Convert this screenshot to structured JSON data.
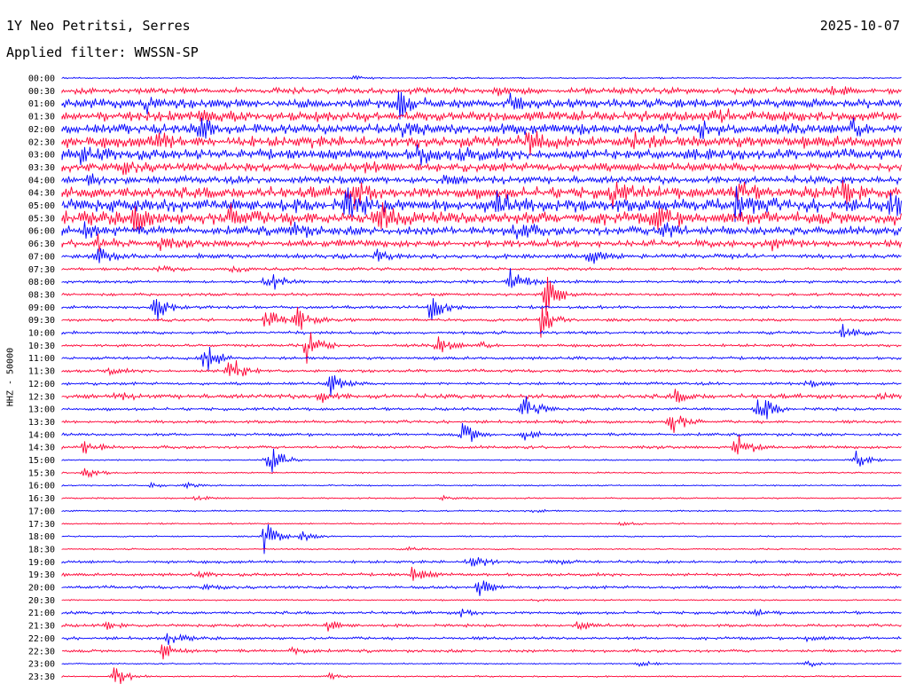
{
  "header": {
    "station": "1Y Neo Petritsi, Serres",
    "filter": "Applied filter: WWSSN-SP",
    "date": "2025-10-07"
  },
  "axis": {
    "ylabel": "HHZ - 50000"
  },
  "colors": {
    "blue": "#0000ff",
    "red": "#ff0033"
  },
  "time_labels": [
    "00:00",
    "00:30",
    "01:00",
    "01:30",
    "02:00",
    "02:30",
    "03:00",
    "03:30",
    "04:00",
    "04:30",
    "05:00",
    "05:30",
    "06:00",
    "06:30",
    "07:00",
    "07:30",
    "08:00",
    "08:30",
    "09:00",
    "09:30",
    "10:00",
    "10:30",
    "11:00",
    "11:30",
    "12:00",
    "12:30",
    "13:00",
    "13:30",
    "14:00",
    "14:30",
    "15:00",
    "15:30",
    "16:00",
    "16:30",
    "17:00",
    "17:30",
    "18:00",
    "18:30",
    "19:00",
    "19:30",
    "20:00",
    "20:30",
    "21:00",
    "21:30",
    "22:00",
    "22:30",
    "23:00",
    "23:30"
  ],
  "trace_activity": {
    "noise": [
      1,
      4,
      6,
      7,
      7,
      8,
      7,
      6,
      5,
      8,
      9,
      9,
      6,
      5,
      3,
      2,
      2,
      2,
      2,
      2,
      2,
      2,
      2,
      2,
      2,
      3,
      2,
      2,
      2,
      2,
      1,
      1,
      1,
      1,
      1,
      1,
      1,
      1,
      2,
      2,
      2,
      1,
      2,
      2,
      2,
      2,
      1,
      1
    ],
    "events": [
      [
        [
          400,
          3
        ]
      ],
      [
        [
          560,
          4
        ],
        [
          940,
          6
        ]
      ],
      [
        [
          165,
          10
        ],
        [
          450,
          18
        ],
        [
          575,
          8
        ]
      ],
      [
        [
          230,
          8
        ],
        [
          810,
          6
        ]
      ],
      [
        [
          225,
          12
        ],
        [
          450,
          10
        ],
        [
          790,
          8
        ],
        [
          960,
          10
        ]
      ],
      [
        [
          175,
          12
        ],
        [
          595,
          16
        ],
        [
          710,
          10
        ]
      ],
      [
        [
          90,
          10
        ],
        [
          470,
          12
        ],
        [
          520,
          8
        ],
        [
          780,
          8
        ]
      ],
      [
        [
          140,
          6
        ],
        [
          410,
          6
        ]
      ],
      [
        [
          100,
          5
        ],
        [
          500,
          5
        ]
      ],
      [
        [
          400,
          14
        ],
        [
          690,
          12
        ],
        [
          830,
          12
        ],
        [
          950,
          12
        ]
      ],
      [
        [
          390,
          16
        ],
        [
          560,
          12
        ],
        [
          830,
          20
        ],
        [
          1005,
          14
        ]
      ],
      [
        [
          150,
          14
        ],
        [
          260,
          12
        ],
        [
          430,
          14
        ],
        [
          740,
          12
        ]
      ],
      [
        [
          95,
          8
        ],
        [
          330,
          10
        ],
        [
          580,
          14
        ],
        [
          745,
          16
        ]
      ],
      [
        [
          110,
          8
        ],
        [
          180,
          6
        ],
        [
          870,
          6
        ]
      ],
      [
        [
          110,
          14
        ],
        [
          425,
          6
        ],
        [
          665,
          10
        ]
      ],
      [
        [
          180,
          4
        ],
        [
          260,
          3
        ]
      ],
      [
        [
          300,
          20
        ],
        [
          575,
          20
        ]
      ],
      [
        [
          615,
          24
        ]
      ],
      [
        [
          175,
          18
        ],
        [
          485,
          22
        ]
      ],
      [
        [
          300,
          16
        ],
        [
          335,
          14
        ],
        [
          610,
          20
        ]
      ],
      [
        [
          950,
          12
        ]
      ],
      [
        [
          345,
          22
        ],
        [
          493,
          12
        ],
        [
          540,
          4
        ]
      ],
      [
        [
          230,
          24
        ]
      ],
      [
        [
          120,
          4
        ],
        [
          258,
          22
        ]
      ],
      [
        [
          372,
          14
        ],
        [
          910,
          4
        ]
      ],
      [
        [
          130,
          4
        ],
        [
          360,
          8
        ],
        [
          760,
          8
        ],
        [
          990,
          4
        ]
      ],
      [
        [
          590,
          22
        ],
        [
          855,
          22
        ]
      ],
      [
        [
          755,
          20
        ]
      ],
      [
        [
          522,
          16
        ],
        [
          590,
          6
        ]
      ],
      [
        [
          95,
          12
        ],
        [
          830,
          24
        ]
      ],
      [
        [
          302,
          26
        ],
        [
          965,
          12
        ]
      ],
      [
        [
          95,
          10
        ]
      ],
      [
        [
          170,
          3
        ],
        [
          210,
          3
        ]
      ],
      [
        [
          220,
          3
        ],
        [
          500,
          3
        ]
      ],
      [
        [
          600,
          2
        ]
      ],
      [
        [
          700,
          2
        ]
      ],
      [
        [
          298,
          20
        ],
        [
          340,
          6
        ]
      ],
      [
        [
          460,
          2
        ]
      ],
      [
        [
          530,
          14
        ],
        [
          620,
          4
        ]
      ],
      [
        [
          465,
          10
        ],
        [
          220,
          3
        ]
      ],
      [
        [
          540,
          12
        ],
        [
          230,
          3
        ]
      ],
      [
        [
          600,
          2
        ]
      ],
      [
        [
          520,
          4
        ],
        [
          850,
          4
        ]
      ],
      [
        [
          120,
          4
        ],
        [
          370,
          6
        ],
        [
          650,
          6
        ]
      ],
      [
        [
          190,
          8
        ],
        [
          910,
          4
        ]
      ],
      [
        [
          182,
          10
        ],
        [
          330,
          6
        ]
      ],
      [
        [
          720,
          4
        ],
        [
          910,
          4
        ]
      ],
      [
        [
          128,
          16
        ],
        [
          370,
          4
        ]
      ]
    ]
  }
}
